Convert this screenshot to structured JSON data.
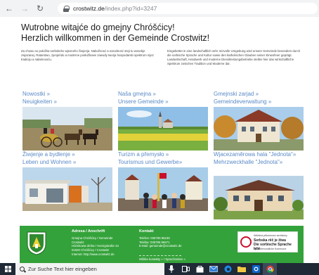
{
  "browser": {
    "back_glyph": "←",
    "forward_glyph": "→",
    "reload_glyph": "↻",
    "url_host": "crostwitz.de",
    "url_path": "/index.php?id=3247"
  },
  "page": {
    "title_line1": "Wutrobne witajće do gmejny Chróšćicy!",
    "title_line2": "Herzlich willkommen in der Gemeinde Crostwitz!",
    "intro_sorbian": "Za chowu so połožka serbskeho wjesneho žiwjenja. Nabožnosć a narodnosć steji tu wosebje zwjazanej. Ratarstwo, zjenjeńdo a moderne posłužbowe zawody tworja hospodarski spektrum mjez tradiciju a nałamnosću.",
    "intro_german": "Eingebettet in eine landschaftlich sehr reizvolle Umgebung wird unsere Gemeinde besonders durch die sorbische Sprache und Kultur sowie den katholischen Glauben seiner Einwohner geprägt. Landwirtschaft, Handwerk und moderne Dienstleistungsbetriebe stellen hier das wirtschaftliche Spektrum zwischen Tradition und Moderne dar."
  },
  "tiles": [
    {
      "sorbian": "Nowostki »",
      "german": "Neuigkeiten »"
    },
    {
      "sorbian": "Naša gmejna »",
      "german": "Unsere Gemeinde »"
    },
    {
      "sorbian": "Gmejnski zarjad »",
      "german": "Gemeindeverwaltung »"
    },
    {
      "sorbian": "Žiwjenje a bydlenje »",
      "german": "Leben und Wohnen »"
    },
    {
      "sorbian": "Turizm a přemysło »",
      "german": "Tourismus und Gewerbe»"
    },
    {
      "sorbian": "Wjacezaměrowa hala \"Jednota\"»",
      "german": "Mehrzweckhalle \"Jednota\"»"
    }
  ],
  "footer": {
    "address_head": "Adresa / Anschrift",
    "address_lines": [
      "Gmejna Chróšćicy / Gemeinde",
      "Crostwitz",
      "Hórnikowa dróha / Hornigstraße 34",
      "01920 Chróšćicy / Crostwitz",
      "Internet: http://www.crostwitz.de"
    ],
    "contact_head": "Kontakt",
    "contact_lines": [
      "Telefon: 035796 96230",
      "Telefax: 035796 96671",
      "E-Mail: gemeinde@crostwitz.de"
    ],
    "contact_link": "Wšitke kontakty » / Sprechzeiten »",
    "badge_small": "Wšědna přitomnosć serbšćiny",
    "badge_line1": "Serbska rěč je žiwa",
    "badge_line2": "Die sorbische Sprache lebt",
    "badge_bottom": "Sprachfreundliche Kommune"
  },
  "taskbar": {
    "search_placeholder": "Zur Suche Text hier eingeben"
  },
  "colors": {
    "link": "#5b8ac7",
    "footer_green": "#34a23a",
    "taskbar": "#1f2a36"
  }
}
